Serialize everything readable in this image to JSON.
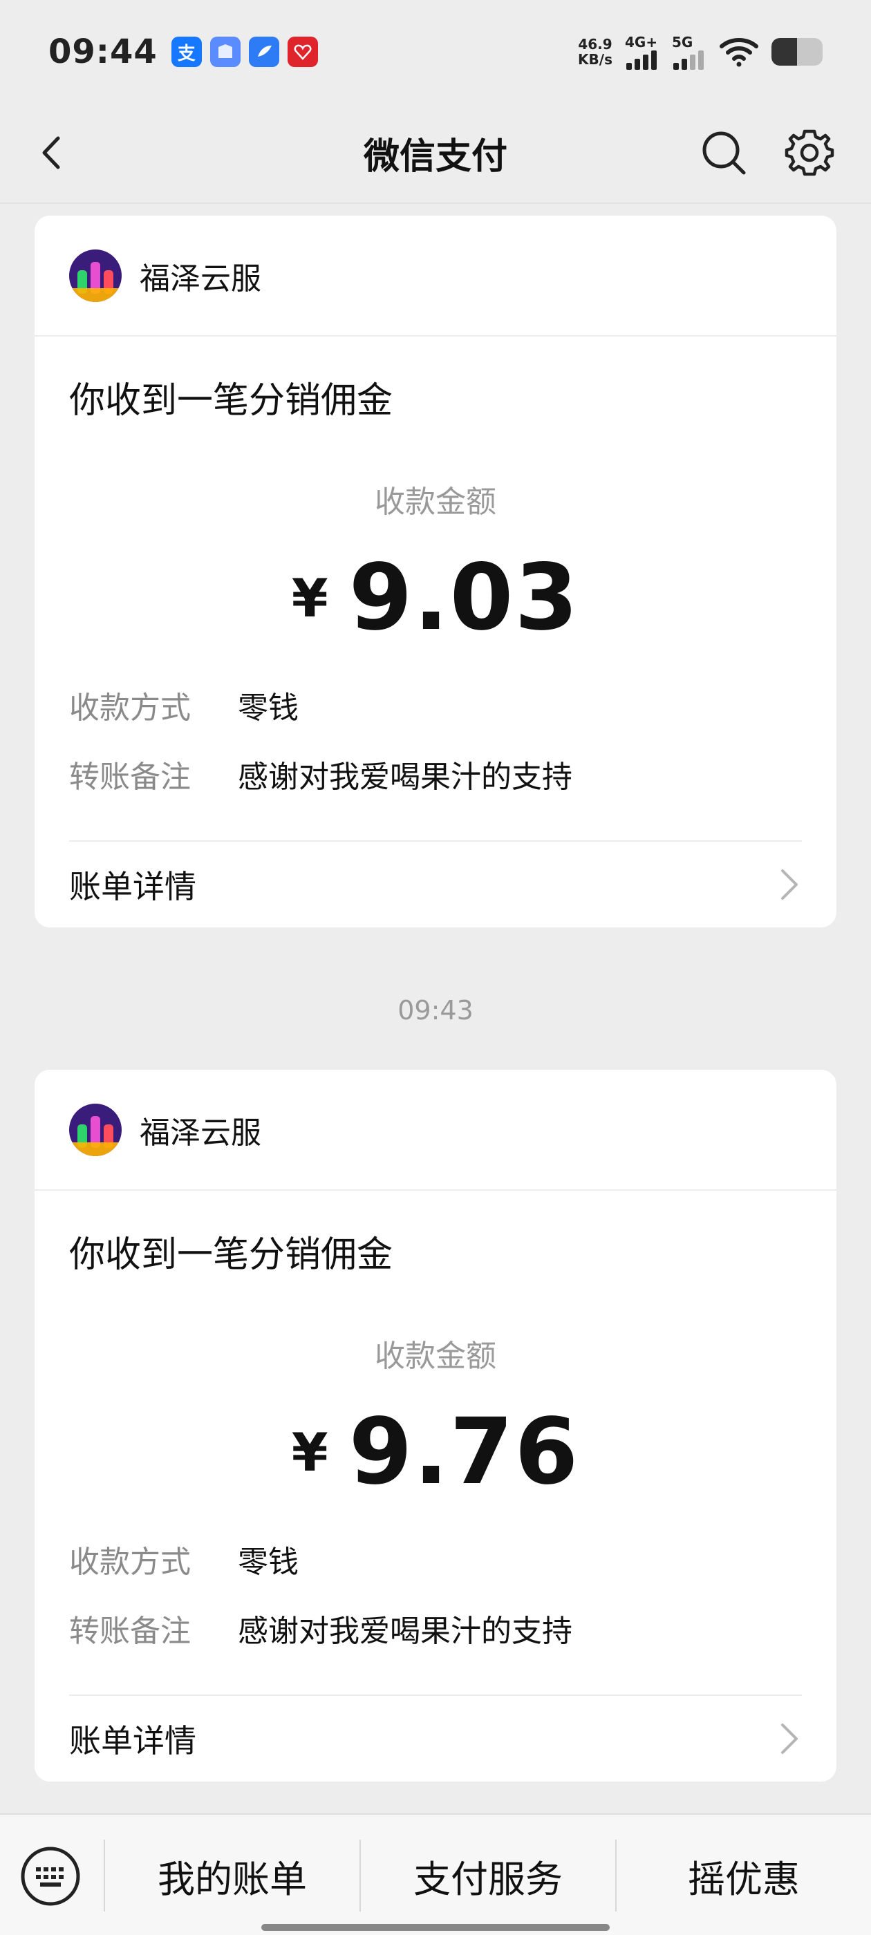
{
  "status_bar": {
    "time": "09:44",
    "app_icons": [
      {
        "name": "alipay-icon",
        "glyph": "支",
        "color": "#1677ff"
      },
      {
        "name": "files-icon",
        "glyph": "",
        "color": "#5b8cff"
      },
      {
        "name": "browser-icon",
        "glyph": "",
        "color": "#2d7cf6"
      },
      {
        "name": "heart-app-icon",
        "glyph": "",
        "color": "#e0242c"
      }
    ],
    "speed_value": "46.9",
    "speed_unit": "KB/s",
    "signal1_label": "4G+",
    "signal2_label": "5G",
    "battery_level": 0.5
  },
  "nav": {
    "title": "微信支付"
  },
  "cards": [
    {
      "merchant": "福泽云服",
      "title": "你收到一笔分销佣金",
      "amount_label": "收款金额",
      "currency": "¥",
      "amount": "9.03",
      "method_key": "收款方式",
      "method_val": "零钱",
      "note_key": "转账备注",
      "note_val": "感谢对我爱喝果汁的支持",
      "detail_label": "账单详情"
    },
    {
      "merchant": "福泽云服",
      "title": "你收到一笔分销佣金",
      "amount_label": "收款金额",
      "currency": "¥",
      "amount": "9.76",
      "method_key": "收款方式",
      "method_val": "零钱",
      "note_key": "转账备注",
      "note_val": "感谢对我爱喝果汁的支持",
      "detail_label": "账单详情"
    }
  ],
  "separator_time": "09:43",
  "bottom_menu": {
    "items": [
      "我的账单",
      "支付服务",
      "摇优惠"
    ]
  }
}
